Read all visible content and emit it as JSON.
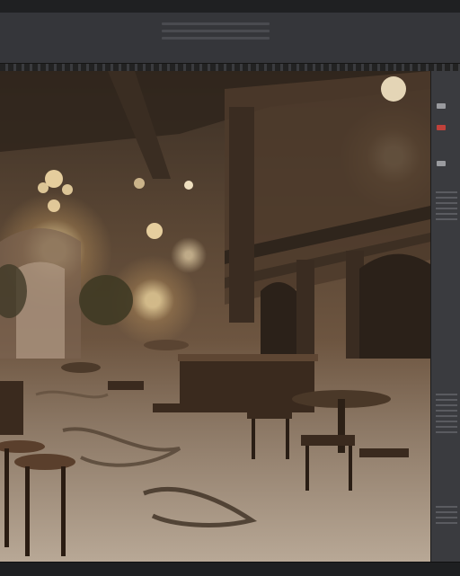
{
  "app": {
    "type": "image-editor"
  },
  "canvas": {
    "image_subject": "ornate-cafe-interior",
    "palette": {
      "shadow": "#3b2f25",
      "midtone": "#6d5540",
      "floor": "#b8a896",
      "light": "#ffebbe"
    }
  },
  "panel_icons": [
    "layer-thumb-icon",
    "color-swatch-icon",
    "toolbar-icon"
  ],
  "accent": "#c0413a"
}
